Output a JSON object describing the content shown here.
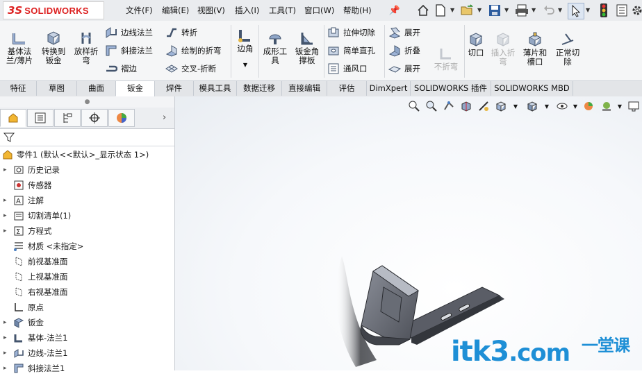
{
  "app": {
    "logo_ds": "3S",
    "logo_text": "SOLIDWORKS"
  },
  "menu": [
    "文件(F)",
    "编辑(E)",
    "视图(V)",
    "插入(I)",
    "工具(T)",
    "窗口(W)",
    "帮助(H)"
  ],
  "quick_access_icons": [
    "home-icon",
    "new-document-icon",
    "open-icon",
    "save-icon",
    "print-icon",
    "undo-icon",
    "select-cursor-icon",
    "traffic-light-icon",
    "file-properties-icon",
    "options-gear-icon"
  ],
  "ribbon": {
    "base_flange": "基体法\n兰/薄片",
    "convert_to_sheet_metal": "转换到\n钣金",
    "lofted_bend": "放样折\n弯",
    "edge_flange": "边线法兰",
    "miter_flange": "斜接法兰",
    "hem": "褶边",
    "jog": "转折",
    "sketched_bend": "绘制的折弯",
    "cross_break": "交叉-折断",
    "corners": "边角",
    "forming_tool": "成形工\n具",
    "sheet_metal_gusset": "钣金角\n撑板",
    "extruded_cut": "拉伸切除",
    "simple_hole": "简单直孔",
    "vent": "通风口",
    "unfold": "展开",
    "fold": "折叠",
    "flatten": "展开",
    "no_bends": "不折弯",
    "rip": "切口",
    "insert_bends": "插入折\n弯",
    "tab_and_slot": "薄片和\n槽口",
    "normal_cut": "正常切\n除"
  },
  "tabs": [
    "特征",
    "草图",
    "曲面",
    "钣金",
    "焊件",
    "模具工具",
    "数据迁移",
    "直接编辑",
    "评估",
    "DimXpert",
    "SOLIDWORKS 插件",
    "SOLIDWORKS MBD"
  ],
  "active_tab": "钣金",
  "tree": {
    "root": "零件1  (默认<<默认>_显示状态 1>)",
    "items": [
      {
        "label": "历史记录",
        "icon": "history-icon",
        "expandable": true
      },
      {
        "label": "传感器",
        "icon": "sensor-icon",
        "expandable": false
      },
      {
        "label": "注解",
        "icon": "annotation-icon",
        "expandable": true
      },
      {
        "label": "切割清单(1)",
        "icon": "cut-list-icon",
        "expandable": true
      },
      {
        "label": "方程式",
        "icon": "equation-icon",
        "expandable": true
      },
      {
        "label": "材质 <未指定>",
        "icon": "material-icon",
        "expandable": false
      },
      {
        "label": "前视基准面",
        "icon": "plane-icon",
        "expandable": false
      },
      {
        "label": "上视基准面",
        "icon": "plane-icon",
        "expandable": false
      },
      {
        "label": "右视基准面",
        "icon": "plane-icon",
        "expandable": false
      },
      {
        "label": "原点",
        "icon": "origin-icon",
        "expandable": false
      },
      {
        "label": "钣金",
        "icon": "sheet-metal-icon",
        "expandable": true
      },
      {
        "label": "基体-法兰1",
        "icon": "base-flange-icon",
        "expandable": true
      },
      {
        "label": "边线-法兰1",
        "icon": "edge-flange-icon",
        "expandable": true
      },
      {
        "label": "斜接法兰1",
        "icon": "miter-flange-icon",
        "expandable": true
      }
    ]
  },
  "watermark": {
    "text": "itk3",
    "suffix": ".com",
    "cn": "一堂课"
  },
  "colors": {
    "accent_red": "#d22020",
    "part_gray": "#5a5d66",
    "watermark_blue": "#1e8fd6"
  }
}
